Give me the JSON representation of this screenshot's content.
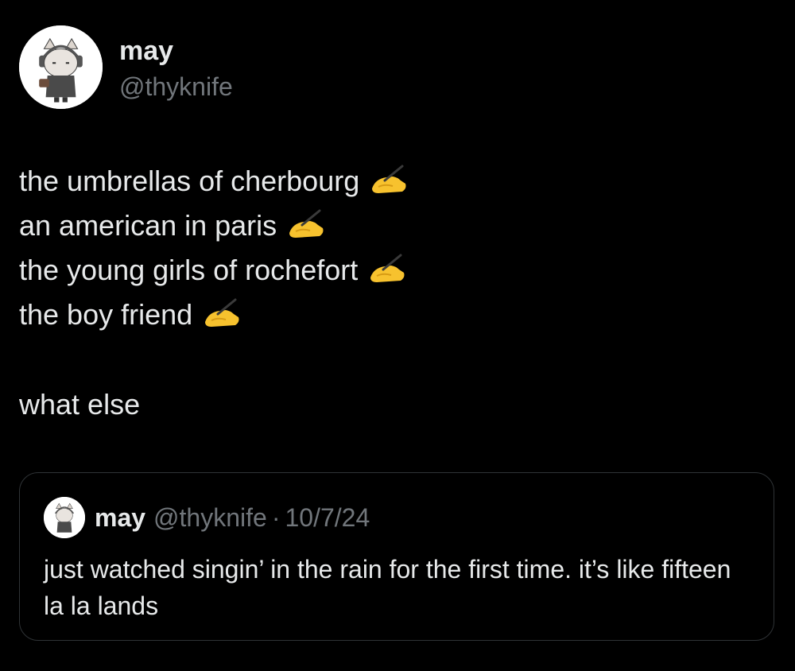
{
  "author": {
    "name": "may",
    "handle": "@thyknife",
    "avatar_icon": "cat-with-headphones-avatar"
  },
  "tweet": {
    "lines": [
      "the umbrellas of cherbourg",
      "an american in paris",
      "the young girls of rochefort",
      "the boy friend"
    ],
    "line_emoji": "writing-hand-icon",
    "closing": "what else"
  },
  "quoted_tweet": {
    "name": "may",
    "handle": "@thyknife",
    "separator": "·",
    "date": "10/7/24",
    "text": "just watched singin’ in the rain for the first time. it’s like fifteen la la lands"
  },
  "colors": {
    "background": "#000000",
    "text": "#e7e9ea",
    "muted": "#71767b",
    "border": "#2f3336",
    "emoji": "#f7c22e"
  }
}
